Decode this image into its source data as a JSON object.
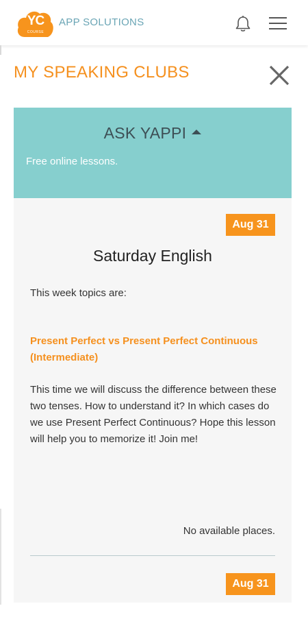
{
  "header": {
    "logo_text": "YC",
    "logo_subtext": "COURSE",
    "brand": "APP SOLUTIONS",
    "icons": [
      "bell-icon",
      "hamburger-menu-icon"
    ]
  },
  "page": {
    "title": "MY SPEAKING CLUBS",
    "close_icon": "close-icon"
  },
  "club_group": {
    "title": "ASK YAPPI",
    "subtitle": "Free online lessons."
  },
  "events": [
    {
      "date": "Aug 31",
      "name": "Saturday English",
      "intro": "This week topics are:",
      "topic": "Present Perfect vs Present Perfect Continuous (Intermediate)",
      "description": "This time we will discuss the difference between these two tenses. How to understand it? In which cases do we use Present Perfect Continuous? Hope this lesson will help you to memorize it! Join me!",
      "availability": "No available places."
    },
    {
      "date": "Aug 31"
    }
  ],
  "colors": {
    "accent_orange": "#f5901e",
    "badge_orange": "#f7941d",
    "teal_header": "#86cfce",
    "brand_teal": "#6aa5b5",
    "panel_bg": "#f6f6f6"
  }
}
